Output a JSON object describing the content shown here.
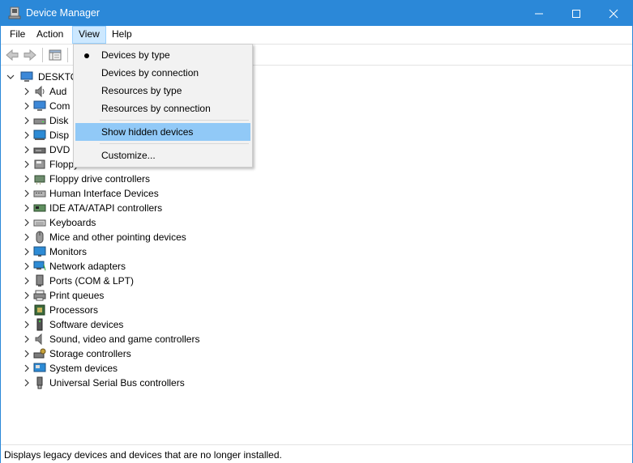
{
  "window": {
    "title": "Device Manager"
  },
  "menubar": {
    "items": [
      "File",
      "Action",
      "View",
      "Help"
    ]
  },
  "view_menu": {
    "items": [
      {
        "label": "Devices by type",
        "checked": true
      },
      {
        "label": "Devices by connection"
      },
      {
        "label": "Resources by type"
      },
      {
        "label": "Resources by connection"
      },
      {
        "label": "Show hidden devices",
        "highlighted": true
      },
      {
        "label": "Customize..."
      }
    ]
  },
  "tree": {
    "root": "DESKTO",
    "children": [
      {
        "label": "Aud",
        "icon": "speaker-icon"
      },
      {
        "label": "Com",
        "icon": "computer-icon"
      },
      {
        "label": "Disk",
        "icon": "disk-drive-icon"
      },
      {
        "label": "Disp",
        "icon": "display-adapter-icon"
      },
      {
        "label": "DVD",
        "icon": "dvd-drive-icon"
      },
      {
        "label": "Floppy disk drives",
        "icon": "floppy-disk-icon"
      },
      {
        "label": "Floppy drive controllers",
        "icon": "floppy-controller-icon"
      },
      {
        "label": "Human Interface Devices",
        "icon": "hid-icon"
      },
      {
        "label": "IDE ATA/ATAPI controllers",
        "icon": "ide-controller-icon"
      },
      {
        "label": "Keyboards",
        "icon": "keyboard-icon"
      },
      {
        "label": "Mice and other pointing devices",
        "icon": "mouse-icon"
      },
      {
        "label": "Monitors",
        "icon": "monitor-icon"
      },
      {
        "label": "Network adapters",
        "icon": "network-adapter-icon"
      },
      {
        "label": "Ports (COM & LPT)",
        "icon": "port-icon"
      },
      {
        "label": "Print queues",
        "icon": "printer-icon"
      },
      {
        "label": "Processors",
        "icon": "processor-icon"
      },
      {
        "label": "Software devices",
        "icon": "software-device-icon"
      },
      {
        "label": "Sound, video and game controllers",
        "icon": "sound-icon"
      },
      {
        "label": "Storage controllers",
        "icon": "storage-controller-icon"
      },
      {
        "label": "System devices",
        "icon": "system-device-icon"
      },
      {
        "label": "Universal Serial Bus controllers",
        "icon": "usb-icon"
      }
    ]
  },
  "statusbar": {
    "text": "Displays legacy devices and devices that are no longer installed."
  },
  "colors": {
    "titlebar": "#2b88d8",
    "menu_active": "#cce8ff",
    "menu_highlight": "#91c9f7"
  }
}
